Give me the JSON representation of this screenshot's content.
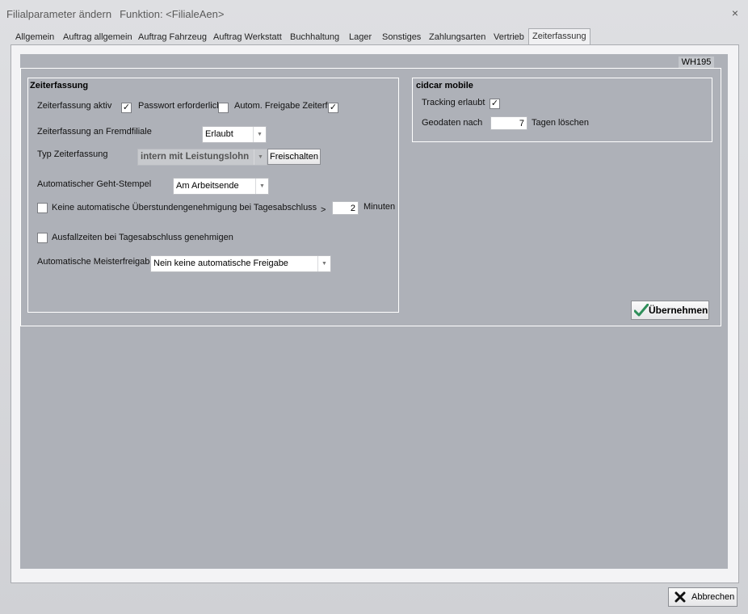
{
  "window": {
    "title": "Filialparameter ändern",
    "function_label": "Funktion: <FilialeAen>",
    "close_symbol": "×"
  },
  "tabs": [
    {
      "label": "Allgemein"
    },
    {
      "label": "Auftrag allgemein"
    },
    {
      "label": "Auftrag Fahrzeug"
    },
    {
      "label": "Auftrag Werkstatt"
    },
    {
      "label": "Buchhaltung"
    },
    {
      "label": "Lager"
    },
    {
      "label": "Sonstiges"
    },
    {
      "label": "Zahlungsarten"
    },
    {
      "label": "Vertrieb"
    },
    {
      "label": "Zeiterfassung",
      "active": true
    }
  ],
  "badge": "WH195",
  "zeiterfassung": {
    "title": "Zeiterfassung",
    "aktiv_label": "Zeiterfassung aktiv",
    "aktiv_checked": "✓",
    "passwort_label": "Passwort erforderlich",
    "passwort_checked": "",
    "autom_freigabe_label": "Autom. Freigabe Zeiterf.",
    "autom_freigabe_checked": "✓",
    "fremdfiliale_label": "Zeiterfassung an Fremdfiliale",
    "fremdfiliale_value": "Erlaubt",
    "typ_label": "Typ Zeiterfassung",
    "typ_value": "intern mit Leistungslohn",
    "freischalten_label": "Freischalten",
    "geht_stempel_label": "Automatischer Geht-Stempel",
    "geht_stempel_value": "Am Arbeitsende",
    "ueberstunden_label": "Keine automatische Überstundengenehmigung bei Tagesabschluss",
    "ueberstunden_checked": "",
    "greater_sign": ">",
    "minuten_value": "2",
    "minuten_label": "Minuten",
    "ausfallzeiten_label": "Ausfallzeiten bei Tagesabschluss genehmigen",
    "ausfallzeiten_checked": "",
    "meisterfreigabe_label": "Automatische Meisterfreigabe",
    "meisterfreigabe_value": "Nein keine automatische Freigabe"
  },
  "cidcar": {
    "title": "cidcar mobile",
    "tracking_label": "Tracking erlaubt",
    "tracking_checked": "✓",
    "geodaten_label": "Geodaten nach",
    "geodaten_value": "7",
    "tagen_label": "Tagen löschen"
  },
  "buttons": {
    "uebernehmen": "Übernehmen",
    "abbrechen": "Abbrechen"
  },
  "icons": {
    "checkmark": "checkmark-icon",
    "cancel": "x-icon",
    "dropdown": "chevron-down-icon"
  },
  "colors": {
    "panel": "#aeb1b8",
    "accent_check": "#2f8f5a"
  }
}
